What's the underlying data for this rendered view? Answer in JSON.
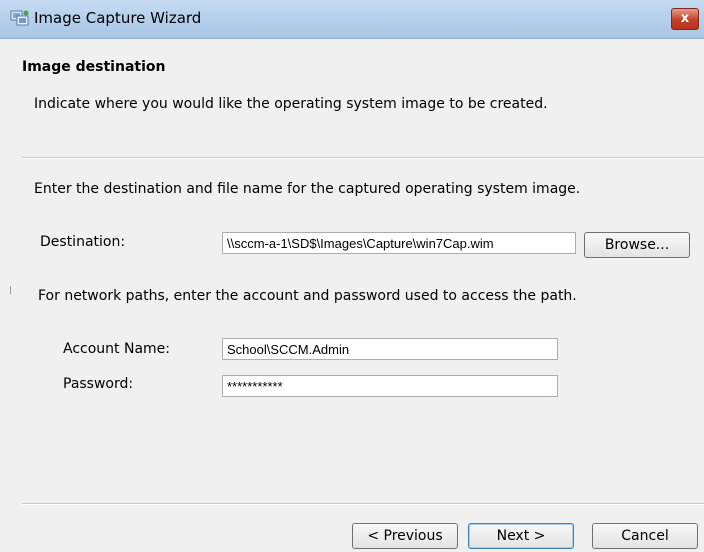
{
  "window": {
    "title": "Image Capture Wizard",
    "close_label": "x"
  },
  "header": {
    "heading": "Image destination",
    "description": "Indicate where you would like the operating system image to be created."
  },
  "main": {
    "instruction": "Enter the destination and file name for the captured operating system image.",
    "destination": {
      "label": "Destination:",
      "value": "\\\\sccm-a-1\\SD$\\Images\\Capture\\win7Cap.wim",
      "browse_label": "Browse..."
    },
    "network_note": "For network paths, enter the account and password used to access the path.",
    "account": {
      "label": "Account Name:",
      "value": "School\\SCCM.Admin"
    },
    "password": {
      "label": "Password:",
      "value": "***********"
    }
  },
  "footer": {
    "previous_label": "< Previous",
    "next_label": "Next >",
    "cancel_label": "Cancel"
  },
  "colors": {
    "titlebar": "#b7d1ec",
    "close": "#c4402a",
    "dialog_bg": "#f0f0f0"
  }
}
